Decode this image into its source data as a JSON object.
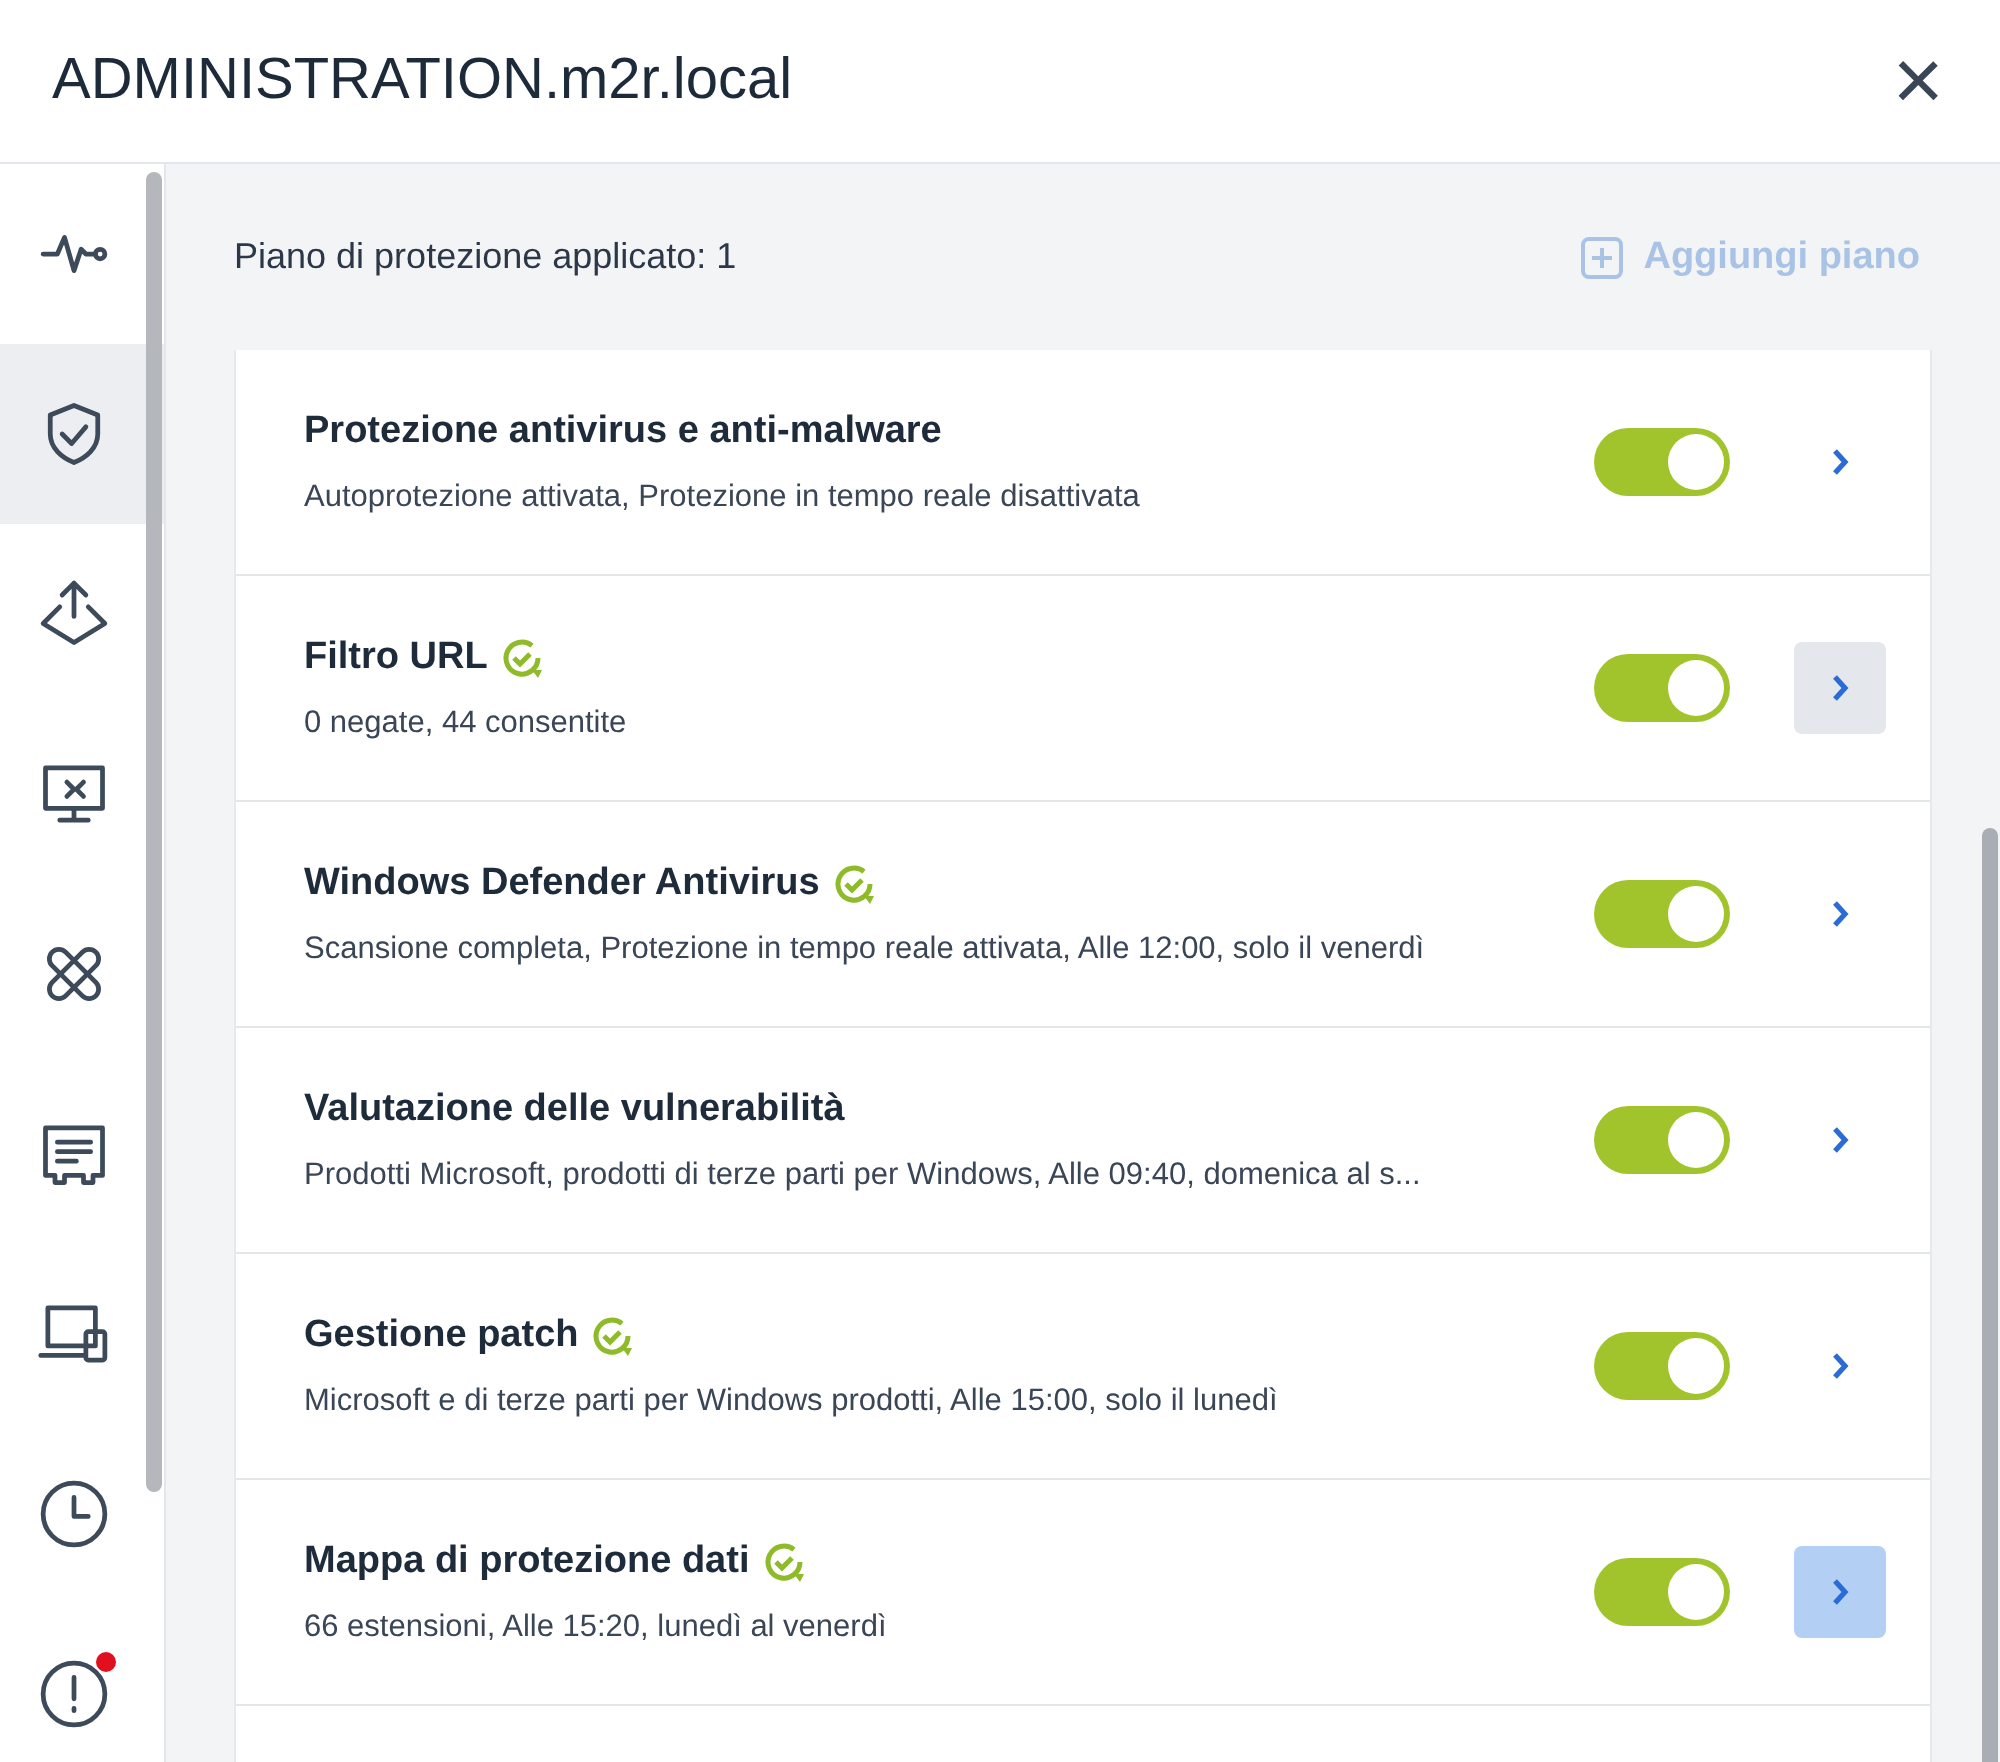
{
  "window": {
    "title": "ADMINISTRATION.m2r.local",
    "close": "×"
  },
  "sidebar": {
    "items": [
      {
        "kind": "activity",
        "selected": false,
        "badge": false
      },
      {
        "kind": "shield",
        "selected": true,
        "badge": false
      },
      {
        "kind": "deploy",
        "selected": false,
        "badge": false
      },
      {
        "kind": "remote",
        "selected": false,
        "badge": false
      },
      {
        "kind": "patch",
        "selected": false,
        "badge": false
      },
      {
        "kind": "inventory",
        "selected": false,
        "badge": false
      },
      {
        "kind": "devices",
        "selected": false,
        "badge": false
      },
      {
        "kind": "clock",
        "selected": false,
        "badge": false
      },
      {
        "kind": "alert",
        "selected": false,
        "badge": true
      }
    ]
  },
  "plan_bar": {
    "label": "Piano di protezione applicato: 1",
    "add_button": {
      "label": "Aggiungi piano",
      "disabled": true
    }
  },
  "modules": [
    {
      "title": "Protezione antivirus e anti-malware",
      "synced": false,
      "subtitle": "Autoprotezione attivata, Protezione in tempo reale disattivata",
      "on": true,
      "hovered": false,
      "selected": false
    },
    {
      "title": "Filtro URL",
      "synced": true,
      "subtitle": "0 negate, 44 consentite",
      "on": true,
      "hovered": true,
      "selected": false
    },
    {
      "title": "Windows Defender Antivirus",
      "synced": true,
      "subtitle": "Scansione completa, Protezione in tempo reale attivata, Alle 12:00, solo il venerdì",
      "on": true,
      "hovered": false,
      "selected": false
    },
    {
      "title": "Valutazione delle vulnerabilità",
      "synced": false,
      "subtitle": "Prodotti Microsoft, prodotti di terze parti per Windows, Alle 09:40, domenica al s...",
      "on": true,
      "hovered": false,
      "selected": false
    },
    {
      "title": "Gestione patch",
      "synced": true,
      "subtitle": "Microsoft e di terze parti per Windows prodotti, Alle 15:00, solo il lunedì",
      "on": true,
      "hovered": false,
      "selected": false
    },
    {
      "title": "Mappa di protezione dati",
      "synced": true,
      "subtitle": "66 estensioni, Alle 15:20, lunedì al venerdì",
      "on": true,
      "hovered": false,
      "selected": true
    }
  ]
}
